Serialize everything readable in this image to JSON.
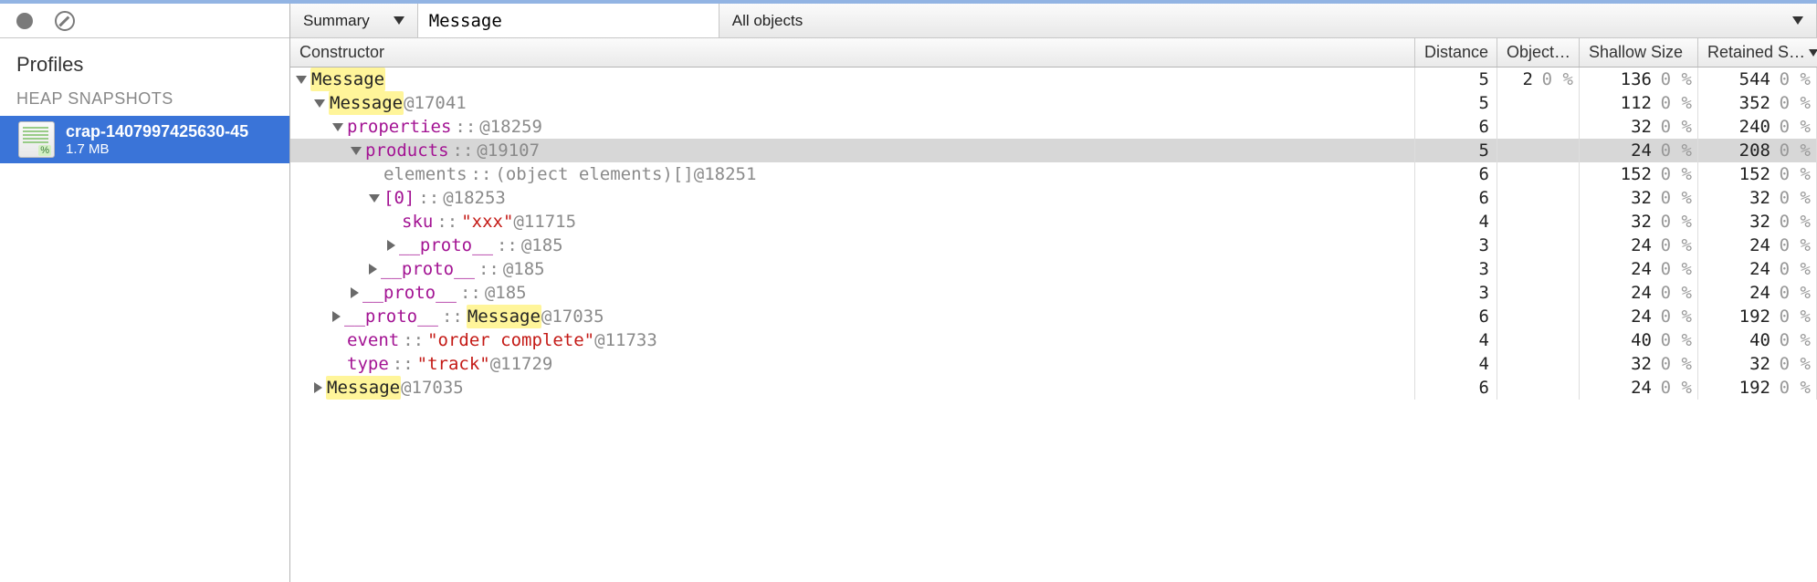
{
  "sidebar": {
    "title": "Profiles",
    "group_label": "HEAP SNAPSHOTS",
    "snapshot": {
      "name": "crap-1407997425630-45",
      "size": "1.7 MB"
    }
  },
  "toolbar": {
    "view_mode": "Summary",
    "filter_value": "Message",
    "scope": "All objects"
  },
  "columns": {
    "constructor": "Constructor",
    "distance": "Distance",
    "objects": "Object…",
    "shallow": "Shallow Size",
    "retained": "Retained S…"
  },
  "rows": [
    {
      "indent": 0,
      "disc": "open",
      "name_parts": [
        {
          "t": "Message",
          "cls": "hl"
        }
      ],
      "dist": "5",
      "obj_v": "2",
      "obj_p": "0 %",
      "sh_v": "136",
      "sh_p": "0 %",
      "ret_v": "544",
      "ret_p": "0 %",
      "sel": false
    },
    {
      "indent": 1,
      "disc": "open",
      "name_parts": [
        {
          "t": "Message",
          "cls": "hl"
        },
        {
          "t": " ",
          "cls": ""
        },
        {
          "t": "@17041",
          "cls": "at"
        }
      ],
      "dist": "5",
      "obj_v": "",
      "obj_p": "",
      "sh_v": "112",
      "sh_p": "0 %",
      "ret_v": "352",
      "ret_p": "0 %",
      "sel": false
    },
    {
      "indent": 2,
      "disc": "open",
      "name_parts": [
        {
          "t": "properties",
          "cls": "prop"
        },
        {
          "t": " :: ",
          "cls": "sep"
        },
        {
          "t": "@18259",
          "cls": "at"
        }
      ],
      "dist": "6",
      "obj_v": "",
      "obj_p": "",
      "sh_v": "32",
      "sh_p": "0 %",
      "ret_v": "240",
      "ret_p": "0 %",
      "sel": false
    },
    {
      "indent": 3,
      "disc": "open",
      "name_parts": [
        {
          "t": "products",
          "cls": "prop"
        },
        {
          "t": " :: ",
          "cls": "sep"
        },
        {
          "t": "@19107",
          "cls": "at"
        }
      ],
      "dist": "5",
      "obj_v": "",
      "obj_p": "",
      "sh_v": "24",
      "sh_p": "0 %",
      "ret_v": "208",
      "ret_p": "0 %",
      "sel": true
    },
    {
      "indent": 4,
      "disc": "none",
      "name_parts": [
        {
          "t": "elements",
          "cls": "at"
        },
        {
          "t": " :: ",
          "cls": "sep"
        },
        {
          "t": "(object elements)[] ",
          "cls": "at"
        },
        {
          "t": "@18251",
          "cls": "at"
        }
      ],
      "dist": "6",
      "obj_v": "",
      "obj_p": "",
      "sh_v": "152",
      "sh_p": "0 %",
      "ret_v": "152",
      "ret_p": "0 %",
      "sel": false
    },
    {
      "indent": 4,
      "disc": "open",
      "name_parts": [
        {
          "t": "[0]",
          "cls": "prop"
        },
        {
          "t": " :: ",
          "cls": "sep"
        },
        {
          "t": "@18253",
          "cls": "at"
        }
      ],
      "dist": "6",
      "obj_v": "",
      "obj_p": "",
      "sh_v": "32",
      "sh_p": "0 %",
      "ret_v": "32",
      "ret_p": "0 %",
      "sel": false
    },
    {
      "indent": 5,
      "disc": "none",
      "name_parts": [
        {
          "t": "sku",
          "cls": "prop"
        },
        {
          "t": " :: ",
          "cls": "sep"
        },
        {
          "t": "\"xxx\"",
          "cls": "str"
        },
        {
          "t": " ",
          "cls": ""
        },
        {
          "t": "@11715",
          "cls": "at"
        }
      ],
      "dist": "4",
      "obj_v": "",
      "obj_p": "",
      "sh_v": "32",
      "sh_p": "0 %",
      "ret_v": "32",
      "ret_p": "0 %",
      "sel": false
    },
    {
      "indent": 5,
      "disc": "closed",
      "name_parts": [
        {
          "t": "__proto__",
          "cls": "prop"
        },
        {
          "t": " :: ",
          "cls": "sep"
        },
        {
          "t": "@185",
          "cls": "at"
        }
      ],
      "dist": "3",
      "obj_v": "",
      "obj_p": "",
      "sh_v": "24",
      "sh_p": "0 %",
      "ret_v": "24",
      "ret_p": "0 %",
      "sel": false
    },
    {
      "indent": 4,
      "disc": "closed",
      "name_parts": [
        {
          "t": "__proto__",
          "cls": "prop"
        },
        {
          "t": " :: ",
          "cls": "sep"
        },
        {
          "t": "@185",
          "cls": "at"
        }
      ],
      "dist": "3",
      "obj_v": "",
      "obj_p": "",
      "sh_v": "24",
      "sh_p": "0 %",
      "ret_v": "24",
      "ret_p": "0 %",
      "sel": false
    },
    {
      "indent": 3,
      "disc": "closed",
      "name_parts": [
        {
          "t": "__proto__",
          "cls": "prop"
        },
        {
          "t": " :: ",
          "cls": "sep"
        },
        {
          "t": "@185",
          "cls": "at"
        }
      ],
      "dist": "3",
      "obj_v": "",
      "obj_p": "",
      "sh_v": "24",
      "sh_p": "0 %",
      "ret_v": "24",
      "ret_p": "0 %",
      "sel": false
    },
    {
      "indent": 2,
      "disc": "closed",
      "name_parts": [
        {
          "t": "__proto__",
          "cls": "prop"
        },
        {
          "t": " :: ",
          "cls": "sep"
        },
        {
          "t": "Message",
          "cls": "hl"
        },
        {
          "t": " ",
          "cls": ""
        },
        {
          "t": "@17035",
          "cls": "at"
        }
      ],
      "dist": "6",
      "obj_v": "",
      "obj_p": "",
      "sh_v": "24",
      "sh_p": "0 %",
      "ret_v": "192",
      "ret_p": "0 %",
      "sel": false
    },
    {
      "indent": 2,
      "disc": "none",
      "name_parts": [
        {
          "t": "event",
          "cls": "prop"
        },
        {
          "t": " :: ",
          "cls": "sep"
        },
        {
          "t": "\"order complete\"",
          "cls": "str"
        },
        {
          "t": " ",
          "cls": ""
        },
        {
          "t": "@11733",
          "cls": "at"
        }
      ],
      "dist": "4",
      "obj_v": "",
      "obj_p": "",
      "sh_v": "40",
      "sh_p": "0 %",
      "ret_v": "40",
      "ret_p": "0 %",
      "sel": false
    },
    {
      "indent": 2,
      "disc": "none",
      "name_parts": [
        {
          "t": "type",
          "cls": "prop"
        },
        {
          "t": " :: ",
          "cls": "sep"
        },
        {
          "t": "\"track\"",
          "cls": "str"
        },
        {
          "t": " ",
          "cls": ""
        },
        {
          "t": "@11729",
          "cls": "at"
        }
      ],
      "dist": "4",
      "obj_v": "",
      "obj_p": "",
      "sh_v": "32",
      "sh_p": "0 %",
      "ret_v": "32",
      "ret_p": "0 %",
      "sel": false
    },
    {
      "indent": 1,
      "disc": "closed",
      "name_parts": [
        {
          "t": "Message",
          "cls": "hl"
        },
        {
          "t": " ",
          "cls": ""
        },
        {
          "t": "@17035",
          "cls": "at"
        }
      ],
      "dist": "6",
      "obj_v": "",
      "obj_p": "",
      "sh_v": "24",
      "sh_p": "0 %",
      "ret_v": "192",
      "ret_p": "0 %",
      "sel": false
    }
  ]
}
